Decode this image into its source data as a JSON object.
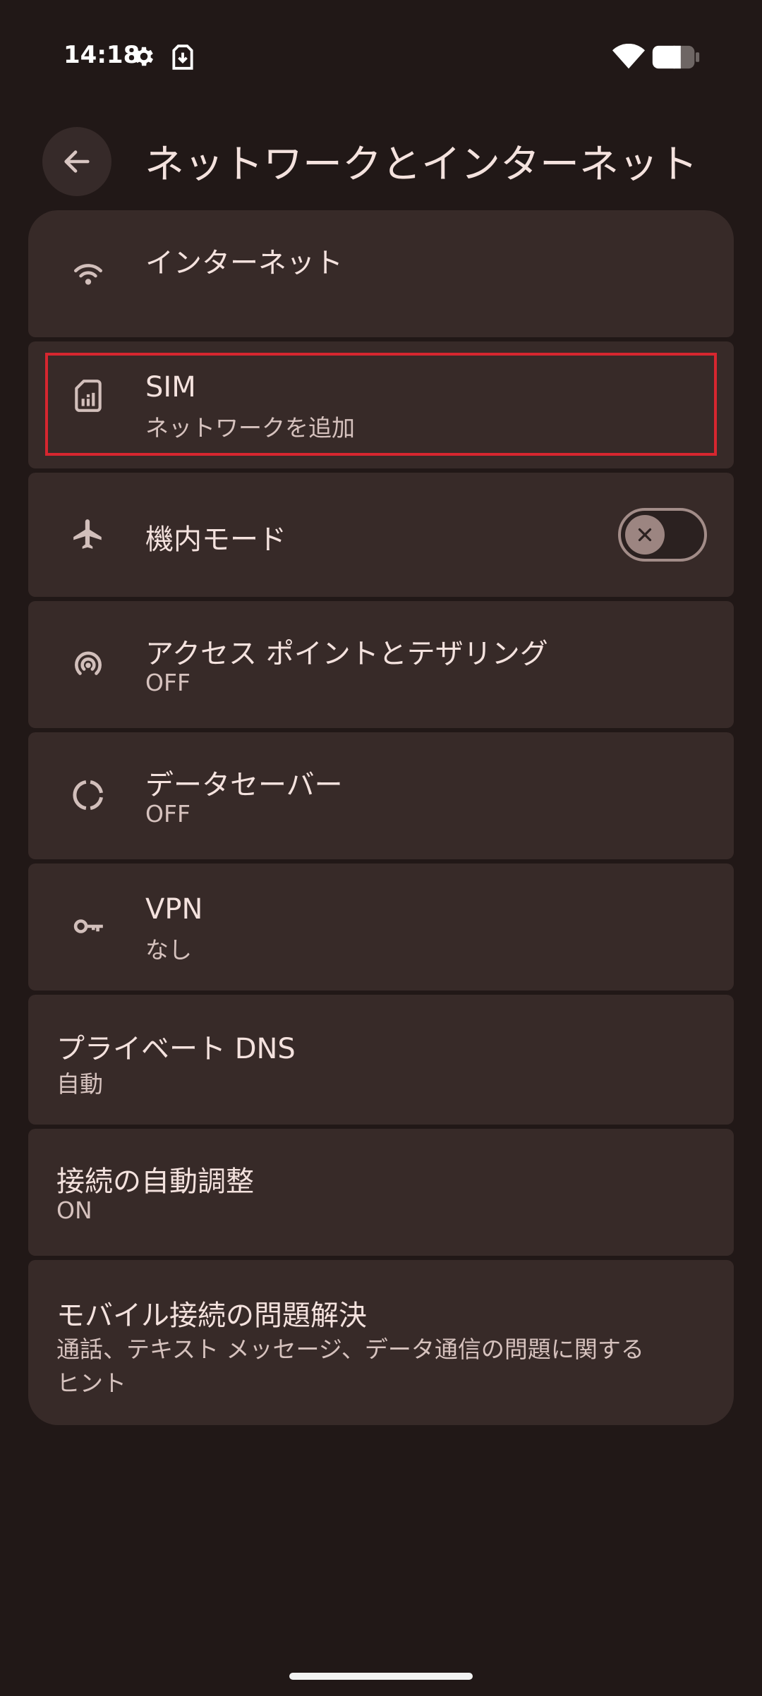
{
  "status_bar": {
    "time": "14:18",
    "icons": [
      "gear-icon",
      "download-icon",
      "wifi-icon",
      "battery-icon"
    ]
  },
  "header": {
    "title": "ネットワークとインターネット",
    "back_icon": "arrow-left-icon"
  },
  "items": [
    {
      "id": "internet",
      "title": "インターネット",
      "summary": "",
      "icon": "wifi-icon"
    },
    {
      "id": "sim",
      "title": "SIM",
      "summary": "ネットワークを追加",
      "icon": "sim-card-icon",
      "highlighted": true
    },
    {
      "id": "airplane",
      "title": "機内モード",
      "summary": "",
      "icon": "airplane-icon",
      "toggle_on": false
    },
    {
      "id": "hotspot",
      "title": "アクセス ポイントとテザリング",
      "summary": "OFF",
      "icon": "hotspot-icon"
    },
    {
      "id": "data-saver",
      "title": "データセーバー",
      "summary": "OFF",
      "icon": "data-saver-icon"
    },
    {
      "id": "vpn",
      "title": "VPN",
      "summary": "なし",
      "icon": "vpn-key-icon"
    },
    {
      "id": "private-dns",
      "title": "プライベート DNS",
      "summary": "自動"
    },
    {
      "id": "adaptive",
      "title": "接続の自動調整",
      "summary": "ON"
    },
    {
      "id": "troubleshoot",
      "title": "モバイル接続の問題解決",
      "summary_line1": "通話、テキスト メッセージ、データ通信の問題に関する",
      "summary_line2": "ヒント"
    }
  ],
  "colors": {
    "background": "#211817",
    "card": "#372a28",
    "highlight": "#d6262f",
    "text_primary": "#f4e2de",
    "text_secondary": "#d6c2be"
  }
}
